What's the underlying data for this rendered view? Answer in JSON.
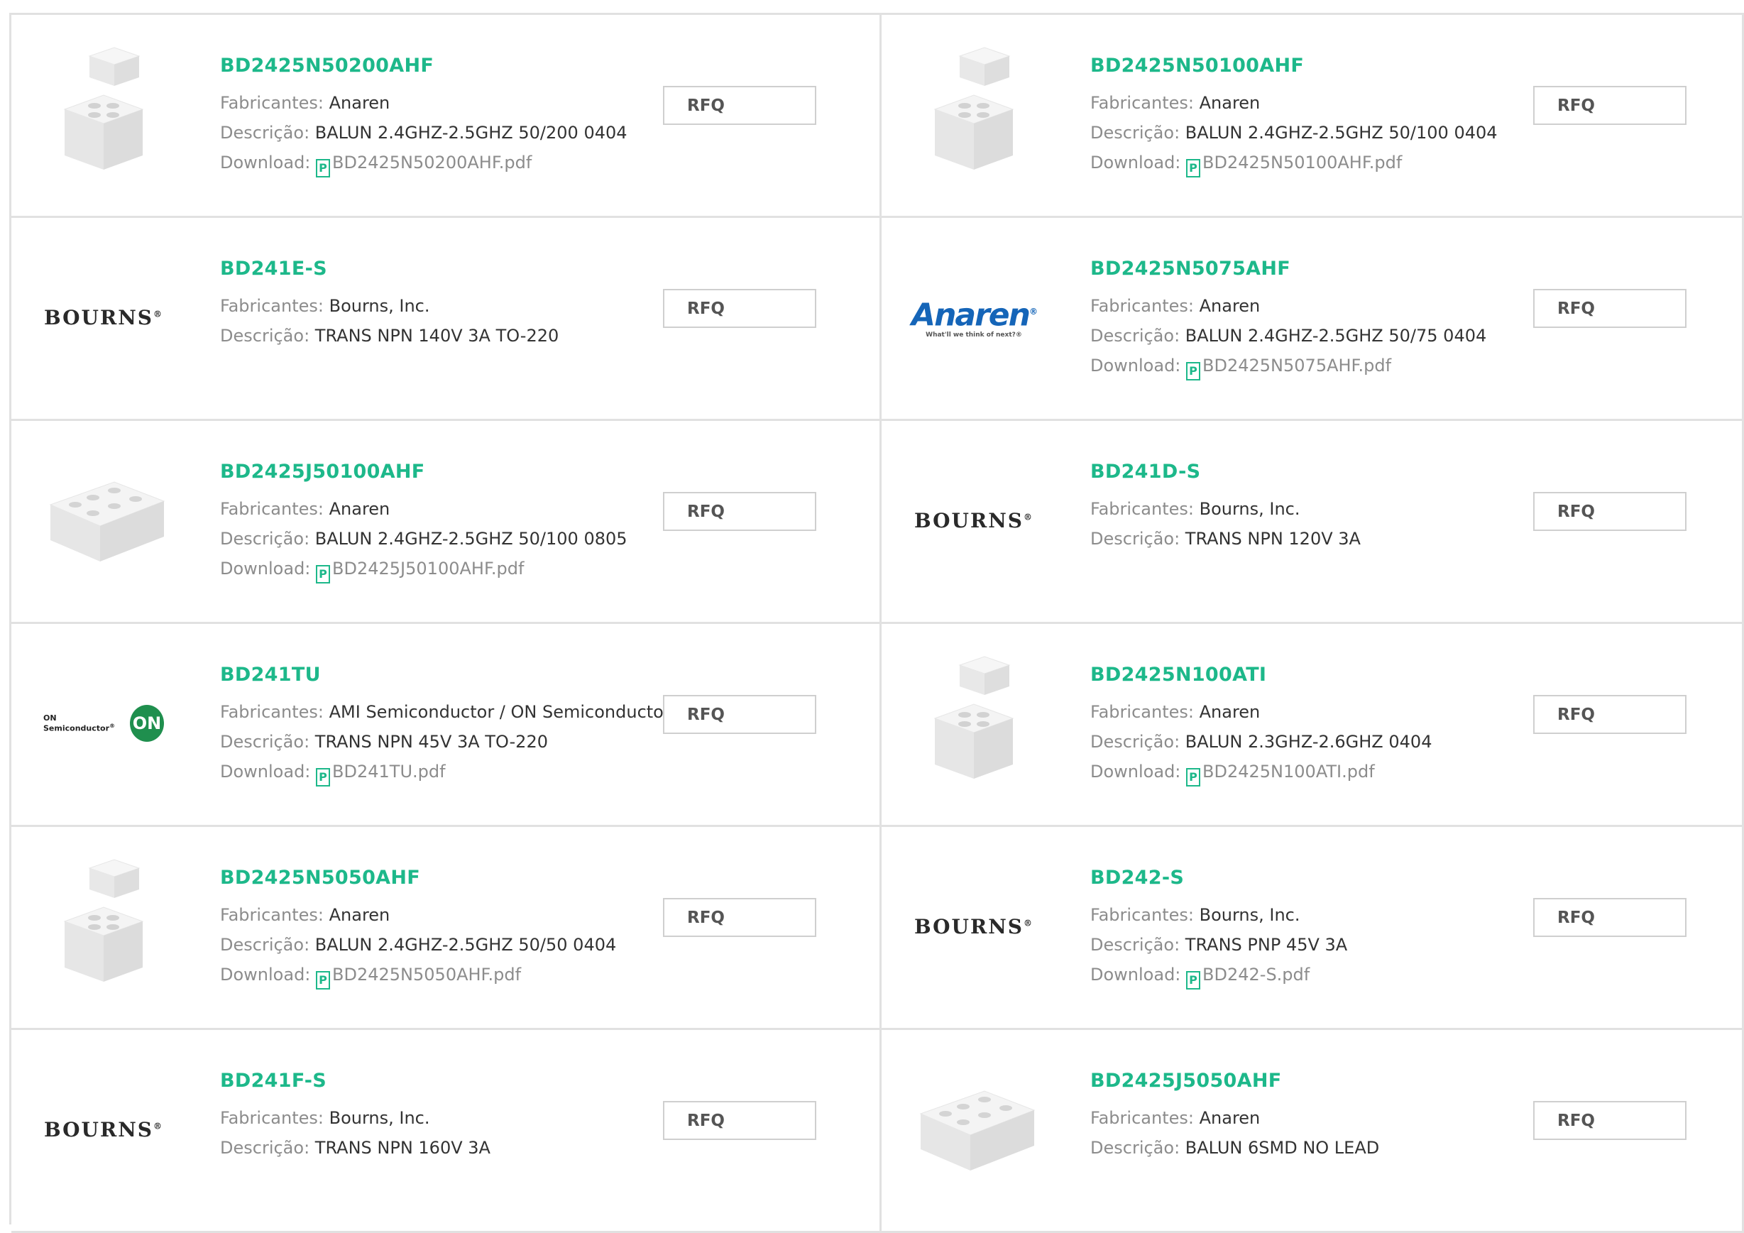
{
  "products": [
    {
      "id": "BD2425N50200AHF",
      "image": "package-3d-0404",
      "manufacturer": "Anaren",
      "description": "BALUN 2.4GHZ-2.5GHZ 50/200 0404",
      "download": "BD2425N50200AHF.pdf",
      "rfq": "RFQ"
    },
    {
      "id": "BD2425N50100AHF",
      "image": "package-3d-0404",
      "manufacturer": "Anaren",
      "description": "BALUN 2.4GHZ-2.5GHZ 50/100 0404",
      "download": "BD2425N50100AHF.pdf",
      "rfq": "RFQ"
    },
    {
      "id": "BD241E-S",
      "image": "bourns-logo",
      "manufacturer": "Bourns, Inc.",
      "description": "TRANS NPN 140V 3A TO-220",
      "download": null,
      "rfq": "RFQ"
    },
    {
      "id": "BD2425N5075AHF",
      "image": "anaren-logo",
      "manufacturer": "Anaren",
      "description": "BALUN 2.4GHZ-2.5GHZ 50/75 0404",
      "download": "BD2425N5075AHF.pdf",
      "rfq": "RFQ"
    },
    {
      "id": "BD2425J50100AHF",
      "image": "package-3d-0805",
      "manufacturer": "Anaren",
      "description": "BALUN 2.4GHZ-2.5GHZ 50/100 0805",
      "download": "BD2425J50100AHF.pdf",
      "rfq": "RFQ"
    },
    {
      "id": "BD241D-S",
      "image": "bourns-logo",
      "manufacturer": "Bourns, Inc.",
      "description": "TRANS NPN 120V 3A",
      "download": null,
      "rfq": "RFQ"
    },
    {
      "id": "BD241TU",
      "image": "onsemi-logo",
      "manufacturer": "AMI Semiconductor / ON Semiconductor",
      "description": "TRANS NPN 45V 3A TO-220",
      "download": "BD241TU.pdf",
      "rfq": "RFQ"
    },
    {
      "id": "BD2425N100ATI",
      "image": "package-3d-0404",
      "manufacturer": "Anaren",
      "description": "BALUN 2.3GHZ-2.6GHZ 0404",
      "download": "BD2425N100ATI.pdf",
      "rfq": "RFQ"
    },
    {
      "id": "BD2425N5050AHF",
      "image": "package-3d-0404",
      "manufacturer": "Anaren",
      "description": "BALUN 2.4GHZ-2.5GHZ 50/50 0404",
      "download": "BD2425N5050AHF.pdf",
      "rfq": "RFQ"
    },
    {
      "id": "BD242-S",
      "image": "bourns-logo",
      "manufacturer": "Bourns, Inc.",
      "description": "TRANS PNP 45V 3A",
      "download": "BD242-S.pdf",
      "rfq": "RFQ"
    },
    {
      "id": "BD241F-S",
      "image": "bourns-logo",
      "manufacturer": "Bourns, Inc.",
      "description": "TRANS NPN 160V 3A",
      "download": null,
      "rfq": "RFQ"
    },
    {
      "id": "BD2425J5050AHF",
      "image": "package-3d-0805",
      "manufacturer": "Anaren",
      "description": "BALUN 6SMD NO LEAD",
      "download": null,
      "rfq": "RFQ"
    }
  ],
  "labels": {
    "manufacturer": "Fabricantes:",
    "description": "Descrição:",
    "download": "Download:",
    "pdf_icon_glyph": "P"
  },
  "logos": {
    "bourns": "BOURNS",
    "bourns_mark": "®",
    "anaren": "Anaren",
    "anaren_mark": "®",
    "anaren_tagline": "What'll we think of next?®",
    "onsemi": "ON Semiconductor",
    "onsemi_mark": "®",
    "onsemi_badge": "ON"
  },
  "colors": {
    "accent": "#1db88a",
    "border": "#e1e1e1",
    "muted": "#8c8c8c",
    "value": "#333333",
    "anaren": "#1565b8",
    "onsemi": "#1f8f4e"
  }
}
